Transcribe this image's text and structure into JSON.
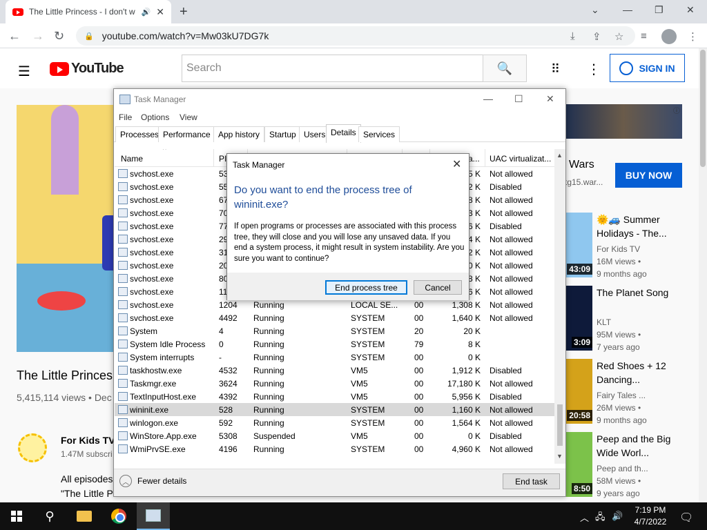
{
  "browser": {
    "tab_title": "The Little Princess - I don't w",
    "url": "youtube.com/watch?v=Mw03kU7DG7k"
  },
  "youtube": {
    "logo_text": "YouTube",
    "search_placeholder": "Search",
    "sign_in": "SIGN IN",
    "video_title": "The Little Princes",
    "video_views": "5,415,114 views • Dec",
    "channel_name": "For Kids TV",
    "channel_subs": "1.47M subscri",
    "desc_line1": "All episodes",
    "desc_line2": "\"The Little P",
    "ad_title": "Wars",
    "ad_sub": "tg15.war...",
    "buy_now": "BUY NOW",
    "recommendations": [
      {
        "title": "🌞🚙 Summer Holidays - The...",
        "channel": "For Kids TV",
        "views": "16M views •",
        "age": "9 months ago",
        "duration": "43:09",
        "color": "#8fc7ef"
      },
      {
        "title": "The Planet Song",
        "channel": "KLT",
        "views": "95M views •",
        "age": "7 years ago",
        "duration": "3:09",
        "color": "#0e1a3a"
      },
      {
        "title": "Red Shoes + 12 Dancing...",
        "channel": "Fairy Tales ...",
        "views": "26M views •",
        "age": "9 months ago",
        "duration": "20:58",
        "color": "#d4a21a"
      },
      {
        "title": "Peep and the Big Wide Worl...",
        "channel": "Peep and th...",
        "views": "58M views •",
        "age": "9 years ago",
        "duration": "8:50",
        "color": "#7cc24a"
      }
    ]
  },
  "task_manager": {
    "title": "Task Manager",
    "menu": [
      "File",
      "Options",
      "View"
    ],
    "tabs": [
      "Processes",
      "Performance",
      "App history",
      "Startup",
      "Users",
      "Details",
      "Services"
    ],
    "active_tab": "Details",
    "columns": [
      "Name",
      "PI",
      "",
      "",
      "",
      "a...",
      "UAC virtualizat..."
    ],
    "rows": [
      {
        "name": "svchost.exe",
        "pid": "53",
        "status": "",
        "user": "",
        "cpu": "",
        "mem": "5 K",
        "uac": "Not allowed"
      },
      {
        "name": "svchost.exe",
        "pid": "55",
        "status": "",
        "user": "",
        "cpu": "",
        "mem": "2 K",
        "uac": "Disabled"
      },
      {
        "name": "svchost.exe",
        "pid": "67",
        "status": "",
        "user": "",
        "cpu": "",
        "mem": "8 K",
        "uac": "Not allowed"
      },
      {
        "name": "svchost.exe",
        "pid": "70",
        "status": "",
        "user": "",
        "cpu": "",
        "mem": "3 K",
        "uac": "Not allowed"
      },
      {
        "name": "svchost.exe",
        "pid": "77",
        "status": "",
        "user": "",
        "cpu": "",
        "mem": "6 K",
        "uac": "Disabled"
      },
      {
        "name": "svchost.exe",
        "pid": "29",
        "status": "",
        "user": "",
        "cpu": "",
        "mem": "4 K",
        "uac": "Not allowed"
      },
      {
        "name": "svchost.exe",
        "pid": "31",
        "status": "",
        "user": "",
        "cpu": "",
        "mem": "2 K",
        "uac": "Not allowed"
      },
      {
        "name": "svchost.exe",
        "pid": "20",
        "status": "",
        "user": "",
        "cpu": "",
        "mem": "0 K",
        "uac": "Not allowed"
      },
      {
        "name": "svchost.exe",
        "pid": "80",
        "status": "",
        "user": "",
        "cpu": "",
        "mem": "8 K",
        "uac": "Not allowed"
      },
      {
        "name": "svchost.exe",
        "pid": "11",
        "status": "",
        "user": "",
        "cpu": "",
        "mem": "6 K",
        "uac": "Not allowed"
      },
      {
        "name": "svchost.exe",
        "pid": "1204",
        "status": "Running",
        "user": "LOCAL SE...",
        "cpu": "00",
        "mem": "1,308 K",
        "uac": "Not allowed"
      },
      {
        "name": "svchost.exe",
        "pid": "4492",
        "status": "Running",
        "user": "SYSTEM",
        "cpu": "00",
        "mem": "1,640 K",
        "uac": "Not allowed"
      },
      {
        "name": "System",
        "pid": "4",
        "status": "Running",
        "user": "SYSTEM",
        "cpu": "20",
        "mem": "20 K",
        "uac": ""
      },
      {
        "name": "System Idle Process",
        "pid": "0",
        "status": "Running",
        "user": "SYSTEM",
        "cpu": "79",
        "mem": "8 K",
        "uac": ""
      },
      {
        "name": "System interrupts",
        "pid": "-",
        "status": "Running",
        "user": "SYSTEM",
        "cpu": "00",
        "mem": "0 K",
        "uac": ""
      },
      {
        "name": "taskhostw.exe",
        "pid": "4532",
        "status": "Running",
        "user": "VM5",
        "cpu": "00",
        "mem": "1,912 K",
        "uac": "Disabled"
      },
      {
        "name": "Taskmgr.exe",
        "pid": "3624",
        "status": "Running",
        "user": "VM5",
        "cpu": "00",
        "mem": "17,180 K",
        "uac": "Not allowed"
      },
      {
        "name": "TextInputHost.exe",
        "pid": "4392",
        "status": "Running",
        "user": "VM5",
        "cpu": "00",
        "mem": "5,956 K",
        "uac": "Disabled"
      },
      {
        "name": "wininit.exe",
        "pid": "528",
        "status": "Running",
        "user": "SYSTEM",
        "cpu": "00",
        "mem": "1,160 K",
        "uac": "Not allowed",
        "selected": true
      },
      {
        "name": "winlogon.exe",
        "pid": "592",
        "status": "Running",
        "user": "SYSTEM",
        "cpu": "00",
        "mem": "1,564 K",
        "uac": "Not allowed"
      },
      {
        "name": "WinStore.App.exe",
        "pid": "5308",
        "status": "Suspended",
        "user": "VM5",
        "cpu": "00",
        "mem": "0 K",
        "uac": "Disabled"
      },
      {
        "name": "WmiPrvSE.exe",
        "pid": "4196",
        "status": "Running",
        "user": "SYSTEM",
        "cpu": "00",
        "mem": "4,960 K",
        "uac": "Not allowed"
      }
    ],
    "fewer_details": "Fewer details",
    "end_task": "End task"
  },
  "dialog": {
    "title": "Task Manager",
    "question": "Do you want to end the process tree of wininit.exe?",
    "body": "If open programs or processes are associated with this process tree, they will close and you will lose any unsaved data. If you end a system process, it might result in system instability. Are you sure you want to continue?",
    "confirm": "End process tree",
    "cancel": "Cancel"
  },
  "taskbar": {
    "time": "7:19 PM",
    "date": "4/7/2022"
  }
}
